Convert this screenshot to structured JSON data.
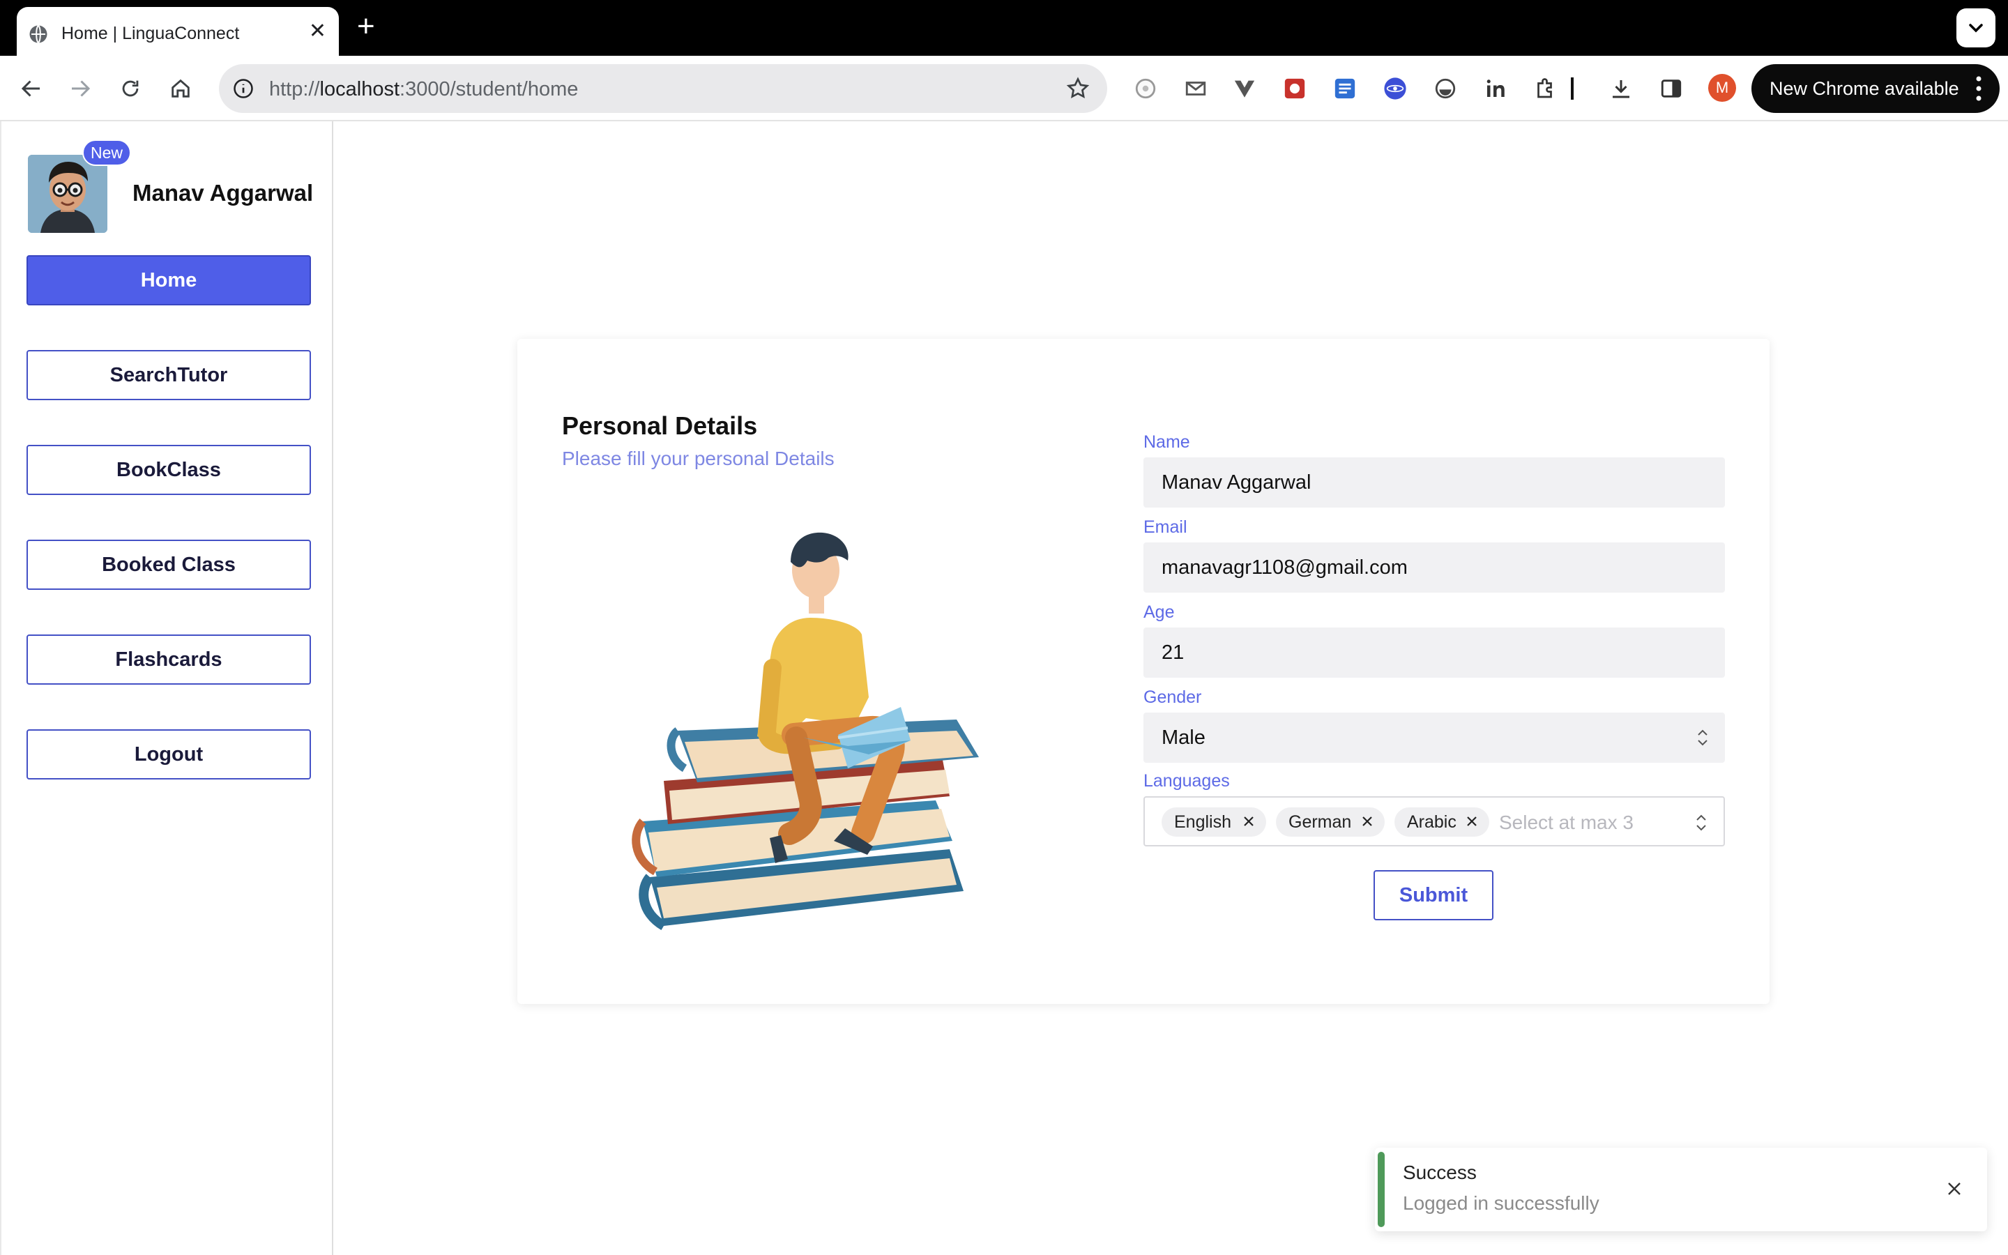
{
  "browser": {
    "tab_title": "Home | LinguaConnect",
    "url_prefix": "http://",
    "url_host": "localhost",
    "url_rest": ":3000/student/home",
    "update_label": "New Chrome available",
    "profile_initial": "M",
    "icons": [
      "back-icon",
      "forward-icon",
      "reload-icon",
      "home-icon",
      "info-icon",
      "star-icon",
      "extension-icons",
      "download-icon",
      "side-panel-icon"
    ]
  },
  "sidebar": {
    "badge": "New",
    "user_name": "Manav Aggarwal",
    "items": [
      {
        "label": "Home",
        "active": true
      },
      {
        "label": "SearchTutor"
      },
      {
        "label": "BookClass"
      },
      {
        "label": "Booked Class"
      },
      {
        "label": "Flashcards"
      },
      {
        "label": "Logout"
      }
    ]
  },
  "form": {
    "title": "Personal Details",
    "subtitle": "Please fill your personal Details",
    "name_label": "Name",
    "name_value": "Manav Aggarwal",
    "email_label": "Email",
    "email_value": "manavagr1108@gmail.com",
    "age_label": "Age",
    "age_value": "21",
    "gender_label": "Gender",
    "gender_value": "Male",
    "languages_label": "Languages",
    "languages": [
      "English",
      "German",
      "Arabic"
    ],
    "languages_placeholder": "Select at max 3",
    "submit_label": "Submit"
  },
  "toast": {
    "title": "Success",
    "message": "Logged in successfully",
    "accent_color": "#4f9a5a"
  },
  "colors": {
    "accent": "#4f5ee8",
    "label": "#5d6ae6"
  }
}
